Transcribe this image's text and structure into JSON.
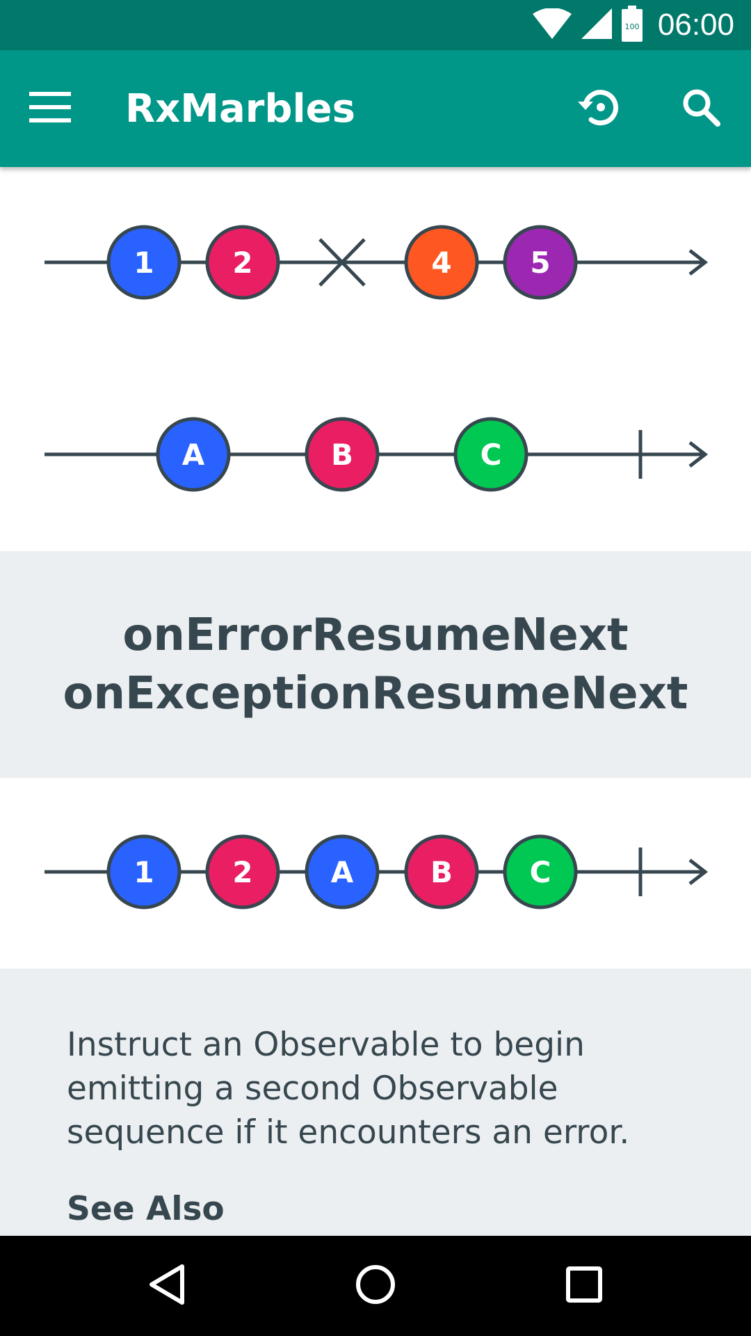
{
  "status_bar": {
    "time": "06:00",
    "battery_level": "100",
    "background": "#00796B"
  },
  "app_bar": {
    "title": "RxMarbles",
    "background": "#009688",
    "icons": [
      "menu-icon",
      "history-icon",
      "search-icon"
    ]
  },
  "marble_colors": {
    "blue": "#2962FF",
    "pink": "#E91E63",
    "orange": "#FF5722",
    "purple": "#9C27B0",
    "green": "#00C853",
    "line": "#37474F"
  },
  "diagram": {
    "source_stream": {
      "items": [
        {
          "label": "1",
          "color": "#2962FF"
        },
        {
          "label": "2",
          "color": "#E91E63"
        },
        {
          "label": "4",
          "color": "#FF5722"
        },
        {
          "label": "5",
          "color": "#9C27B0"
        }
      ],
      "error_marker": "cross"
    },
    "resume_stream": {
      "items": [
        {
          "label": "A",
          "color": "#2962FF"
        },
        {
          "label": "B",
          "color": "#E91E63"
        },
        {
          "label": "C",
          "color": "#00C853"
        }
      ],
      "completion_marker": "vertical-bar"
    },
    "result_stream": {
      "items": [
        {
          "label": "1",
          "color": "#2962FF"
        },
        {
          "label": "2",
          "color": "#E91E63"
        },
        {
          "label": "A",
          "color": "#2962FF"
        },
        {
          "label": "B",
          "color": "#E91E63"
        },
        {
          "label": "C",
          "color": "#00C853"
        }
      ],
      "completion_marker": "vertical-bar"
    }
  },
  "operator": {
    "line1": "onErrorResumeNext",
    "line2": "onExceptionResumeNext"
  },
  "description": {
    "text": "Instruct an Observable to begin emitting a second Observable sequence if it encounters an error.",
    "see_also": "See Also"
  },
  "nav_bar": {
    "icons": [
      "back-icon",
      "home-icon",
      "recents-icon"
    ]
  }
}
